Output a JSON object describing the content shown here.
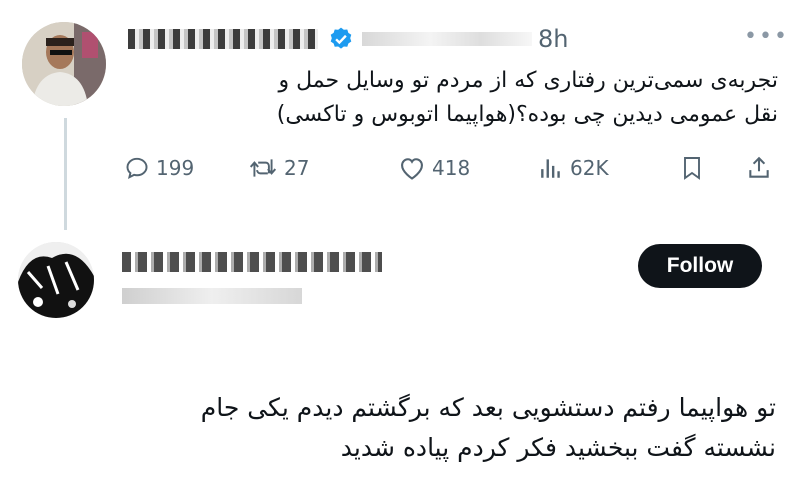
{
  "original_tweet": {
    "time": "8h",
    "more_label": "•••",
    "text_line1": "تجربه‌ی سمی‌ترین رفتاری که از مردم تو وسایل حمل و",
    "text_line2": "نقل عمومی دیدین چی بوده؟(هواپیما اتوبوس و تاکسی)",
    "actions": {
      "replies": "199",
      "retweets": "27",
      "likes": "418",
      "views": "62K"
    },
    "icons": [
      "reply-icon",
      "retweet-icon",
      "like-icon",
      "views-icon",
      "bookmark-icon",
      "share-icon"
    ]
  },
  "reply": {
    "follow_label": "Follow",
    "text_line1": "تو هواپیما رفتم دستشویی بعد که برگشتم دیدم یکی جام",
    "text_line2": "نشسته گفت ببخشید فکر کردم پیاده شدید"
  },
  "colors": {
    "verified": "#1d9bf0",
    "muted": "#536471",
    "follow_bg": "#0f1419"
  }
}
